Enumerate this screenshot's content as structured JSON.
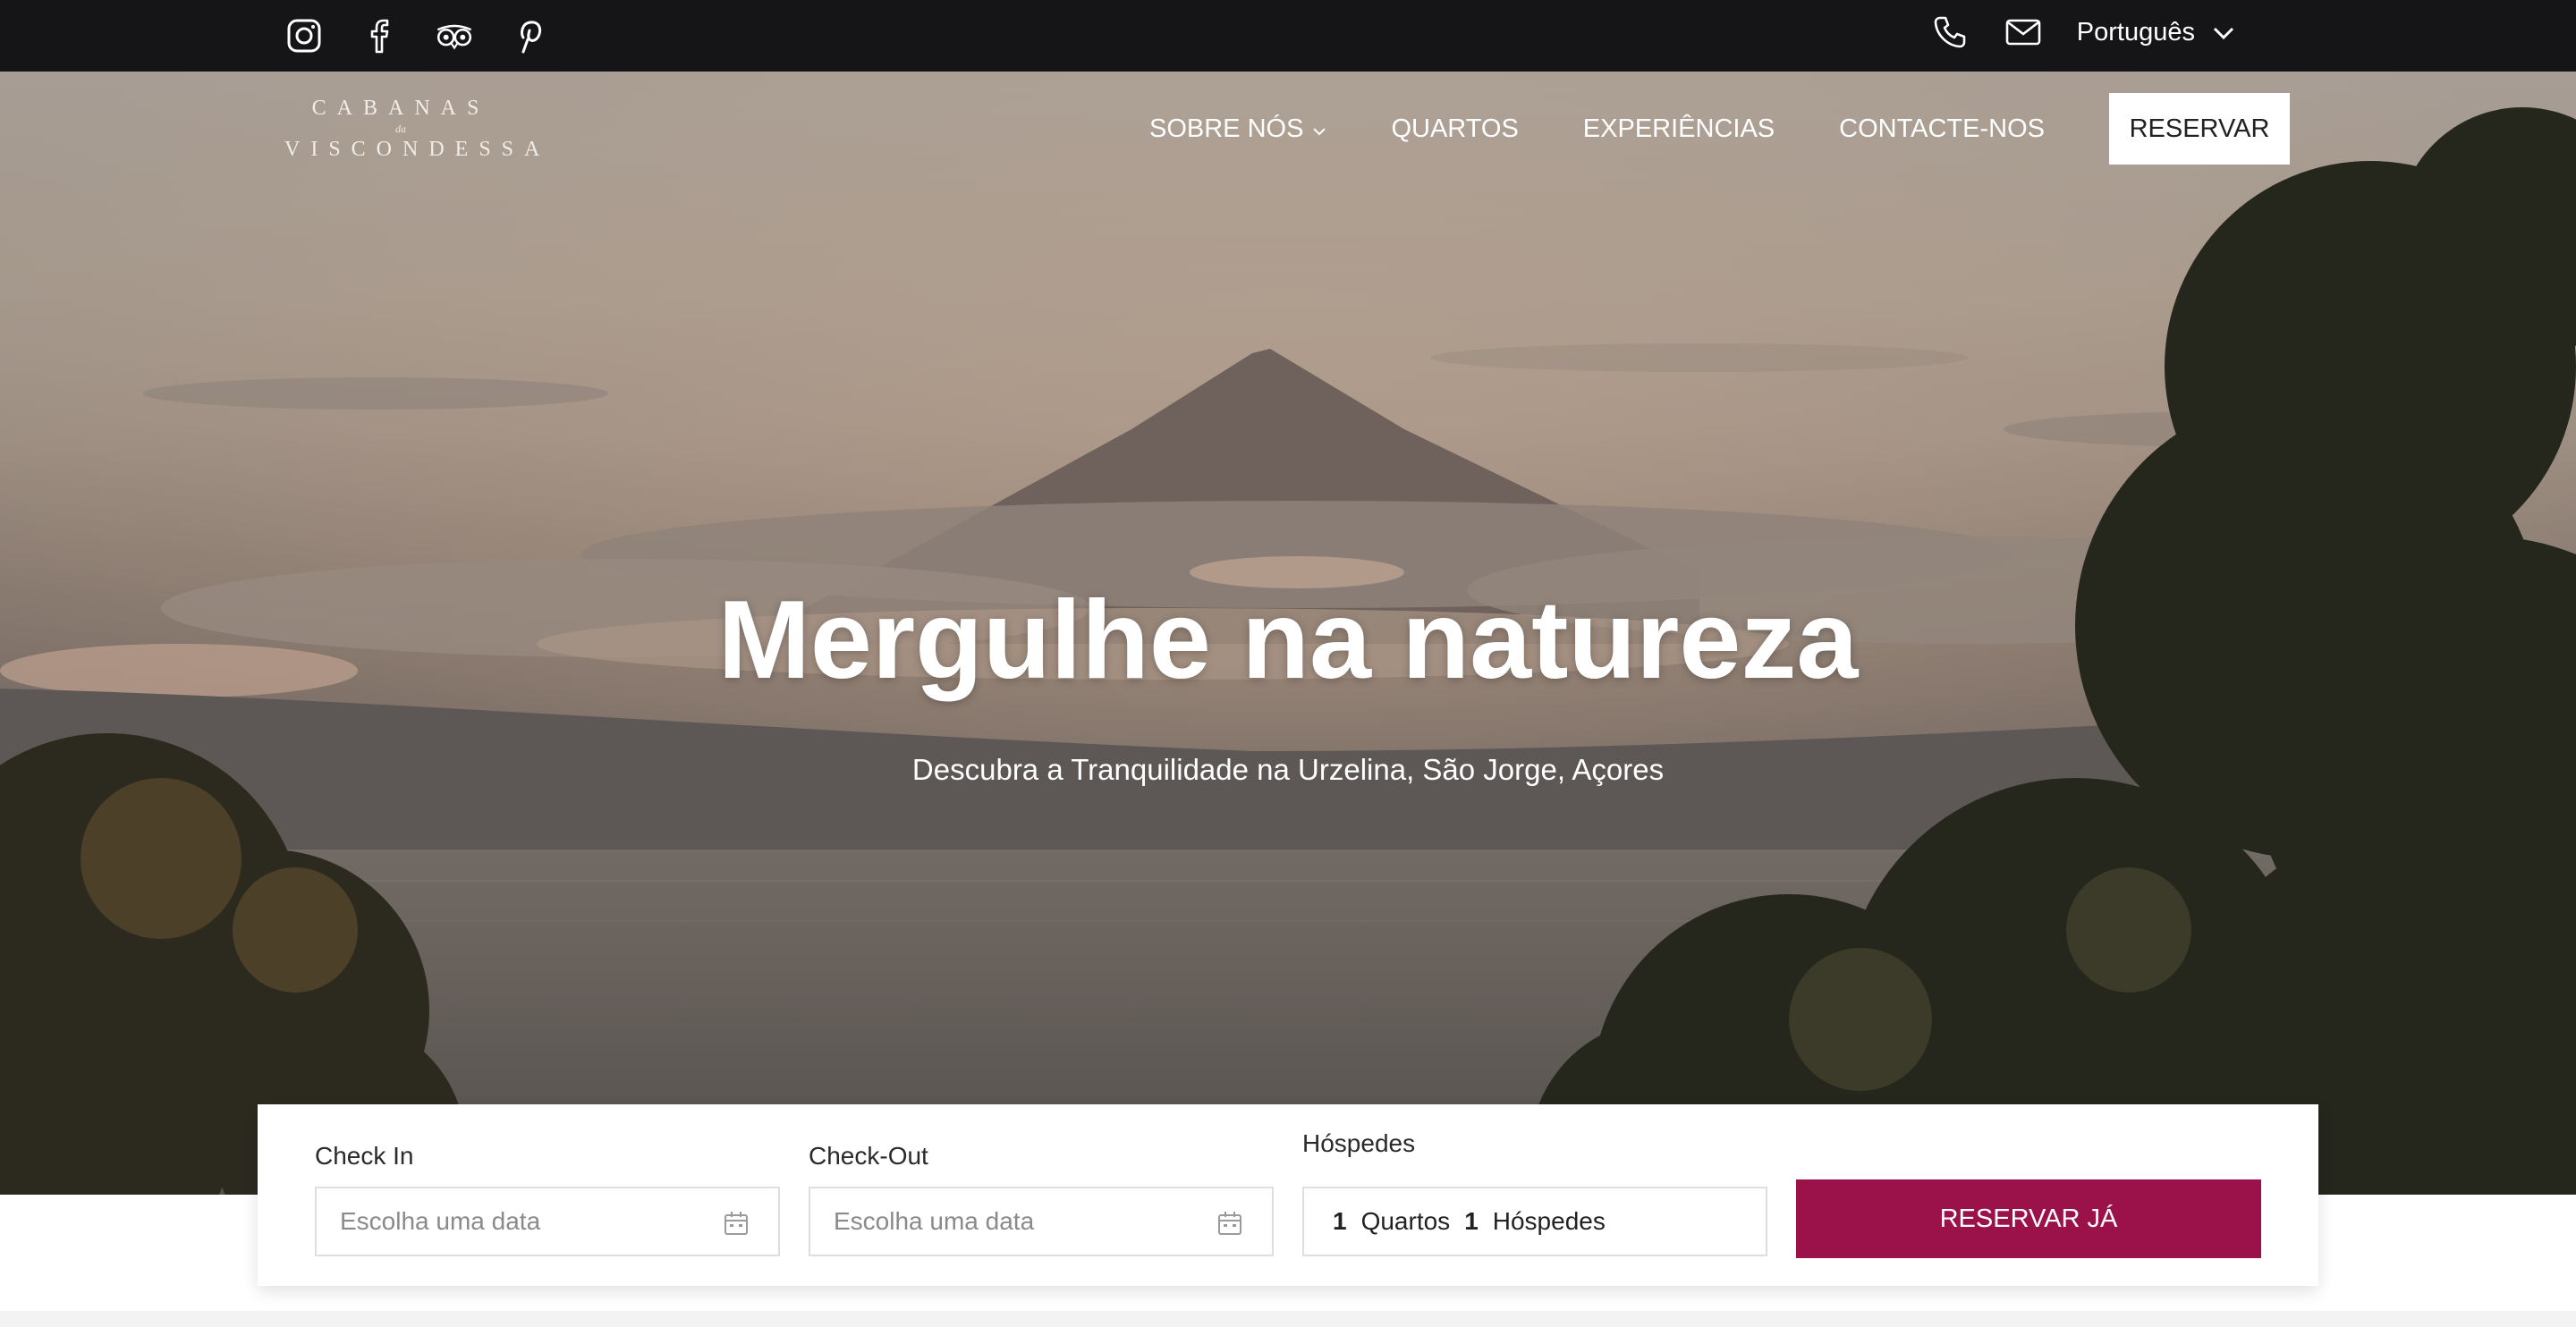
{
  "topbar": {
    "social_icons": [
      "instagram-icon",
      "facebook-icon",
      "tripadvisor-icon",
      "pinterest-icon"
    ],
    "contact_icons": [
      "phone-icon",
      "mail-icon"
    ],
    "language": "Português"
  },
  "logo": {
    "line1": "CABANAS",
    "line2": "da",
    "line3": "VISCONDESSA"
  },
  "nav": {
    "items": [
      "SOBRE NÓS",
      "QUARTOS",
      "EXPERIÊNCIAS",
      "CONTACTE-NOS"
    ],
    "reserve": "RESERVAR"
  },
  "hero": {
    "title": "Mergulhe na natureza",
    "subtitle": "Descubra a Tranquilidade na Urzelina, São Jorge, Açores"
  },
  "booking": {
    "checkin_label": "Check In",
    "checkin_placeholder": "Escolha uma data",
    "checkout_label": "Check-Out",
    "checkout_placeholder": "Escolha uma data",
    "guests_label": "Hóspedes",
    "rooms_count": "1",
    "rooms_label": "Quartos",
    "guests_count": "1",
    "guests_text": "Hóspedes",
    "button": "RESERVAR JÁ"
  },
  "colors": {
    "topbar": "#151518",
    "accent": "#9b124b"
  }
}
